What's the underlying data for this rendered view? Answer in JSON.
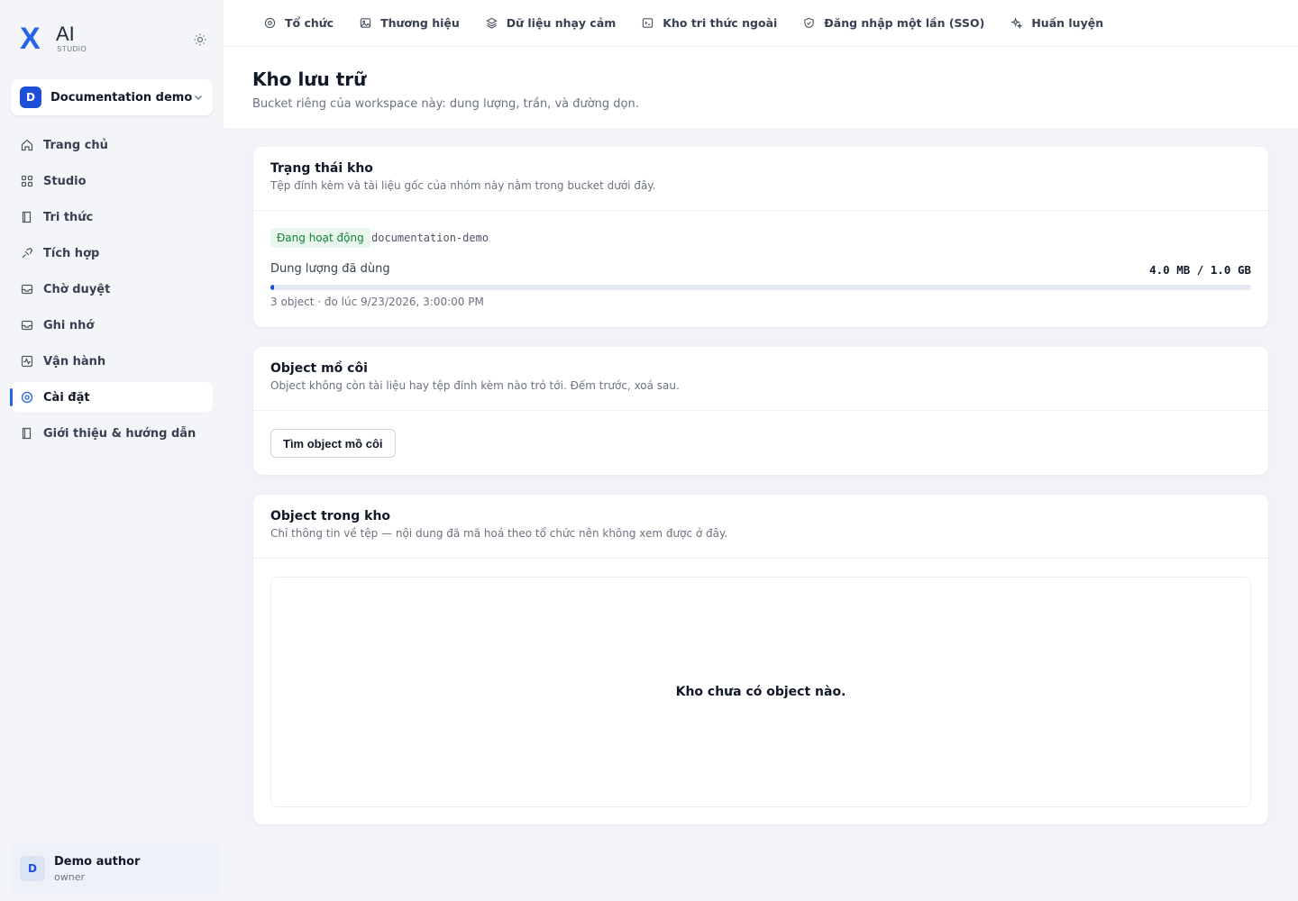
{
  "brand": {
    "mark": "X",
    "name": "AI",
    "sub": "STUDIO"
  },
  "workspace": {
    "initial": "D",
    "name": "Documentation demo"
  },
  "nav": [
    {
      "label": "Trang chủ",
      "icon": "home-icon"
    },
    {
      "label": "Studio",
      "icon": "grid-icon"
    },
    {
      "label": "Tri thức",
      "icon": "book-icon"
    },
    {
      "label": "Tích hợp",
      "icon": "plug-icon"
    },
    {
      "label": "Chờ duyệt",
      "icon": "inbox-icon"
    },
    {
      "label": "Ghi nhớ",
      "icon": "memory-icon"
    },
    {
      "label": "Vận hành",
      "icon": "activity-icon"
    },
    {
      "label": "Cài đặt",
      "icon": "gear-icon",
      "active": true
    },
    {
      "label": "Giới thiệu & hướng dẫn",
      "icon": "guide-icon"
    }
  ],
  "user": {
    "initial": "D",
    "name": "Demo author",
    "role": "owner"
  },
  "tabs": [
    {
      "label": "Tổ chức",
      "icon": "org-icon"
    },
    {
      "label": "Thương hiệu",
      "icon": "image-icon"
    },
    {
      "label": "Dữ liệu nhạy cảm",
      "icon": "layers-icon"
    },
    {
      "label": "Kho tri thức ngoài",
      "icon": "terminal-icon"
    },
    {
      "label": "Đăng nhập một lần (SSO)",
      "icon": "shield-icon"
    },
    {
      "label": "Huấn luyện",
      "icon": "sparkle-icon"
    }
  ],
  "page": {
    "title": "Kho lưu trữ",
    "subtitle": "Bucket riêng của workspace này: dung lượng, trần, và đường dọn."
  },
  "status_card": {
    "title": "Trạng thái kho",
    "subtitle": "Tệp đính kèm và tài liệu gốc của nhóm này nằm trong bucket dưới đây.",
    "status": "Đang hoạt động",
    "bucket": "documentation-demo",
    "usage_label": "Dung lượng đã dùng",
    "usage_value": "4.0 MB / 1.0 GB",
    "usage_fraction": 0.0039,
    "meta": "3 object · đo lúc 9/23/2026, 3:00:00 PM"
  },
  "orphan_card": {
    "title": "Object mồ côi",
    "subtitle": "Object không còn tài liệu hay tệp đính kèm nào trỏ tới. Đếm trước, xoá sau.",
    "button": "Tìm object mồ côi"
  },
  "objects_card": {
    "title": "Object trong kho",
    "subtitle": "Chỉ thông tin về tệp — nội dung đã mã hoá theo tổ chức nên không xem được ở đây.",
    "empty": "Kho chưa có object nào."
  }
}
